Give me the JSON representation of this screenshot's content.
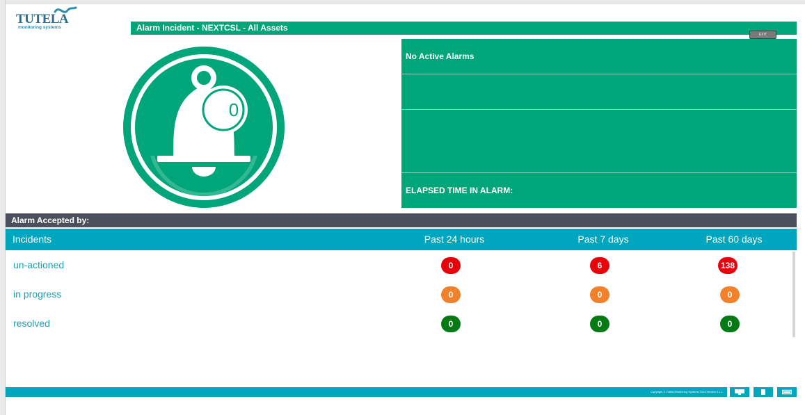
{
  "logo": {
    "word": "TUTELA",
    "sub": "monitoring systems"
  },
  "title": "Alarm Incident  -  NEXTCSL  -  All Assets",
  "exit_label": "EXIT",
  "bell": {
    "count": "0"
  },
  "status": {
    "active_alarms": "No Active Alarms",
    "row2": "",
    "row3": "",
    "elapsed_label": "ELAPSED TIME IN ALARM:"
  },
  "accepted_by": "Alarm Accepted by:",
  "incidents": {
    "header": {
      "label": "Incidents",
      "col1": "Past 24 hours",
      "col2": "Past 7 days",
      "col3": "Past 60 days"
    },
    "rows": [
      {
        "label": "un-actioned",
        "values": [
          "0",
          "6",
          "138"
        ],
        "color": "#e8000b"
      },
      {
        "label": "in progress",
        "values": [
          "0",
          "0",
          "0"
        ],
        "color": "#f2812c"
      },
      {
        "label": "resolved",
        "values": [
          "0",
          "0",
          "0"
        ],
        "color": "#047a15"
      }
    ]
  },
  "footer": {
    "copyright": "Copyright © Tutela Monitoring Systems 2018 Version 4.1.1",
    "icons": [
      "monitor-icon",
      "document-icon",
      "window-icon"
    ]
  },
  "colors": {
    "green": "#00a57a",
    "teal": "#00a6bd",
    "dark_bar": "#4b505c",
    "red": "#e8000b",
    "orange": "#f2812c",
    "dark_green": "#047a15"
  }
}
